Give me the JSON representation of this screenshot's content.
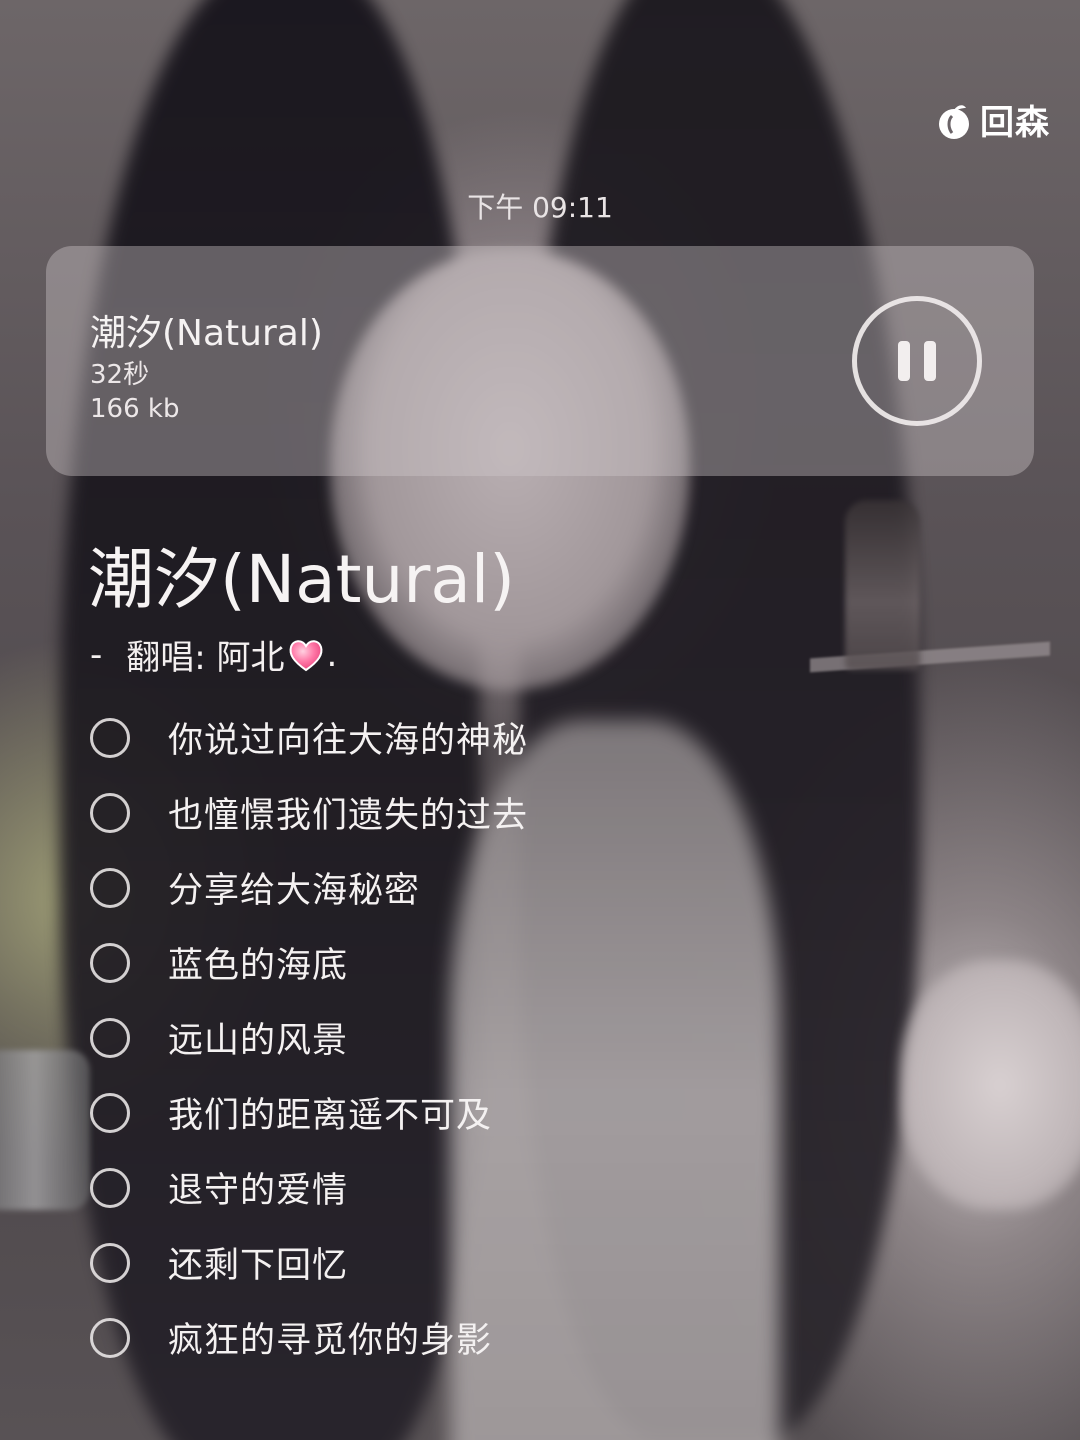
{
  "watermark": {
    "text": "回森",
    "icon": "peach-logo-icon"
  },
  "status": {
    "time": "下午 09:11"
  },
  "player": {
    "title": "潮汐(Natural)",
    "duration": "32秒",
    "size": "166 kb",
    "state": "playing",
    "control_icon": "pause-icon"
  },
  "song": {
    "title": "潮汐(Natural)",
    "dash": "-",
    "cover_label": "翻唱: 阿北",
    "cover_decoration": "heart-icon",
    "cover_tail": "."
  },
  "lyrics": [
    "你说过向往大海的神秘",
    "也憧憬我们遗失的过去",
    "分享给大海秘密",
    "蓝色的海底",
    "远山的风景",
    "我们的距离遥不可及",
    "退守的爱情",
    "还剩下回忆",
    "疯狂的寻觅你的身影"
  ],
  "colors": {
    "card_bg": "#d0c8ca",
    "text": "#f4f1f1",
    "heart": "#ff6b9a"
  }
}
